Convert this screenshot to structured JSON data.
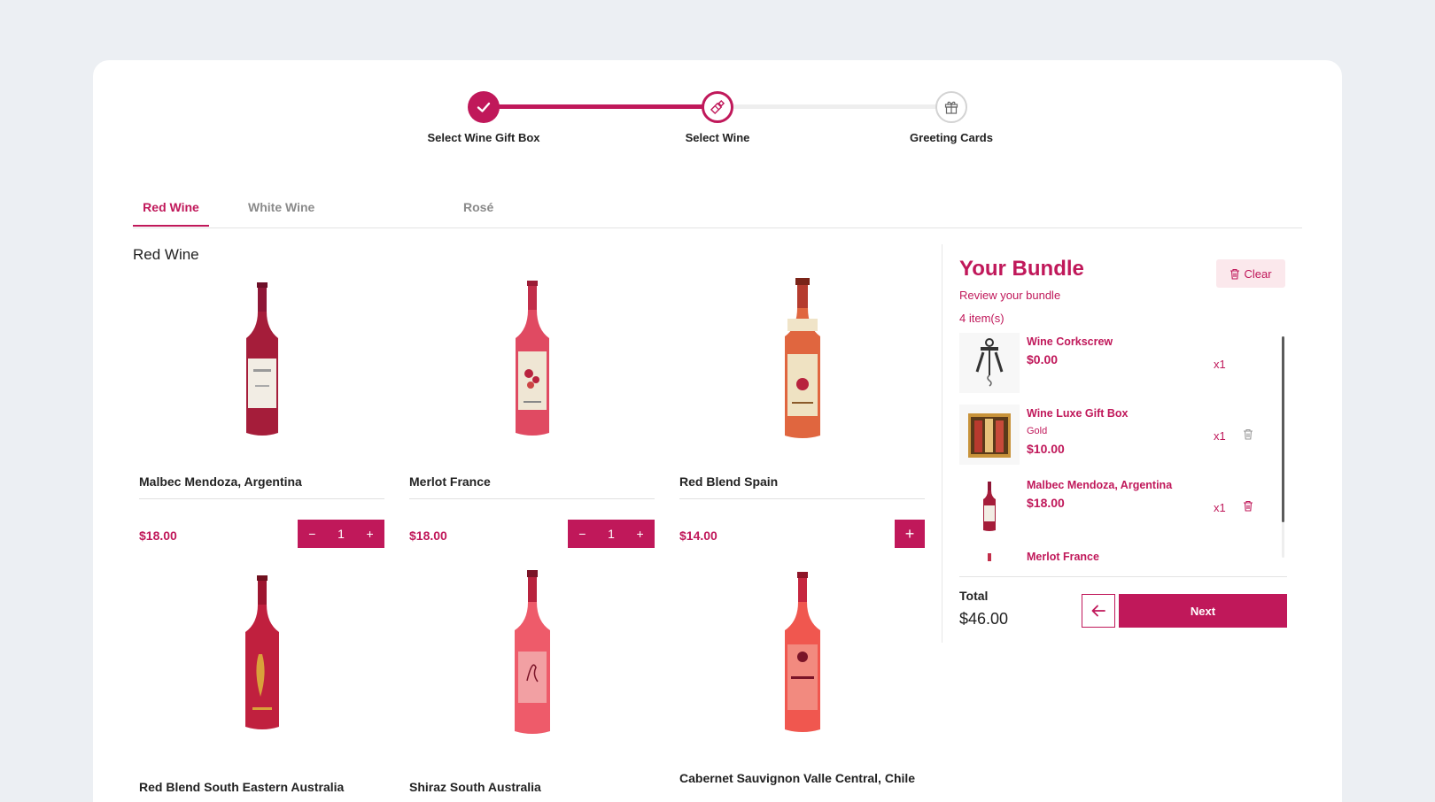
{
  "colors": {
    "accent": "#c0185a",
    "background": "#eceff3"
  },
  "stepper": {
    "steps": [
      {
        "label": "Select Wine Gift Box",
        "status": "done",
        "icon": "check-icon"
      },
      {
        "label": "Select Wine",
        "status": "active",
        "icon": "wine-bottle-icon"
      },
      {
        "label": "Greeting Cards",
        "status": "todo",
        "icon": "gift-icon"
      }
    ]
  },
  "tabs": [
    {
      "label": "Red Wine",
      "active": true
    },
    {
      "label": "White Wine",
      "active": false
    },
    {
      "label": "Rosé",
      "active": false
    }
  ],
  "section_title": "Red Wine",
  "products": [
    {
      "name": "Malbec Mendoza, Argentina",
      "price": "$18.00",
      "quantity": "1"
    },
    {
      "name": "Merlot France",
      "price": "$18.00",
      "quantity": "1"
    },
    {
      "name": "Red Blend Spain",
      "price": "$14.00"
    },
    {
      "name": "Red Blend South Eastern Australia"
    },
    {
      "name": "Shiraz South Australia"
    },
    {
      "name": "Cabernet Sauvignon Valle Central, Chile"
    }
  ],
  "bundle": {
    "title": "Your Bundle",
    "subtitle": "Review your bundle",
    "count": "4 item(s)",
    "clear_label": "Clear",
    "items": [
      {
        "name": "Wine Corkscrew",
        "price": "$0.00",
        "qty": "x1",
        "icon": "corkscrew-icon"
      },
      {
        "name": "Wine Luxe Gift Box",
        "variant": "Gold",
        "price": "$10.00",
        "qty": "x1",
        "icon": "gift-box-icon"
      },
      {
        "name": "Malbec Mendoza, Argentina",
        "price": "$18.00",
        "qty": "x1",
        "icon": "wine-bottle-icon"
      },
      {
        "name": "Merlot France"
      }
    ],
    "total_label": "Total",
    "total_value": "$46.00",
    "next_label": "Next"
  }
}
